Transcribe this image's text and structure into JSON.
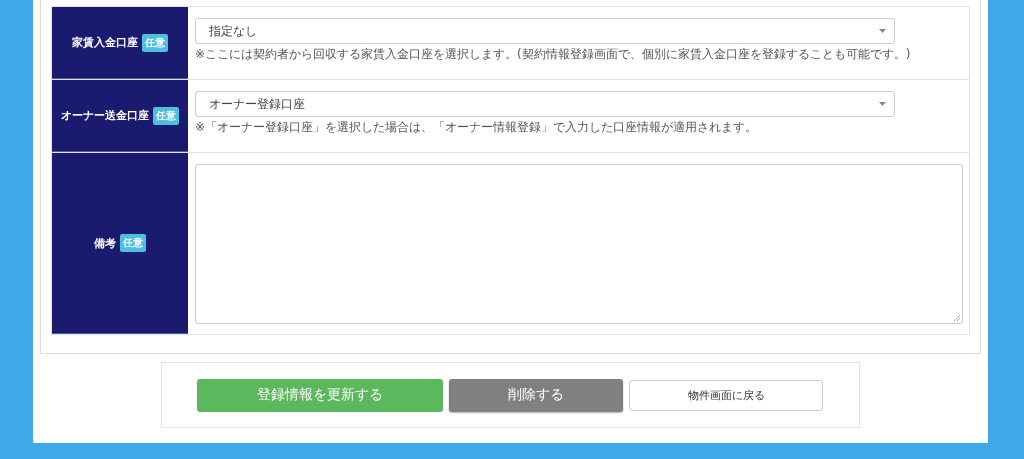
{
  "rows": [
    {
      "kind": "select",
      "label": "家賃入金口座",
      "badge": "任意",
      "value": "指定なし",
      "note": "※ここには契約者から回収する家賃入金口座を選択します。(契約情報登録画面で、個別に家賃入金口座を登録することも可能です。)"
    },
    {
      "kind": "select",
      "label": "オーナー送金口座",
      "badge": "任意",
      "value": "オーナー登録口座",
      "note": "※「オーナー登録口座」を選択した場合は、「オーナー情報登録」で入力した口座情報が適用されます。"
    },
    {
      "kind": "textarea",
      "label": "備考",
      "badge": "任意"
    }
  ],
  "buttons": [
    {
      "kind": "primary",
      "label": "登録情報を更新する"
    },
    {
      "kind": "danger",
      "label": "削除する"
    },
    {
      "kind": "plain",
      "label": "物件画面に戻る"
    }
  ]
}
